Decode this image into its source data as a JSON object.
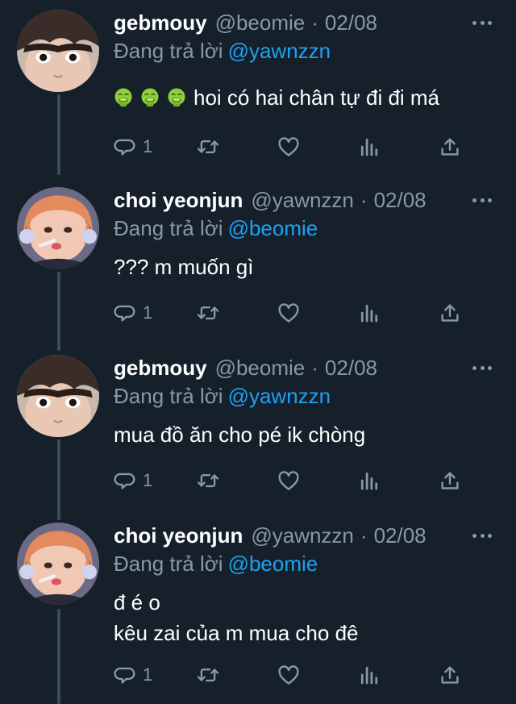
{
  "reply_prefix": "Đang trả lời",
  "icons": {
    "reply": "reply-icon",
    "retweet": "retweet-icon",
    "like": "heart-icon",
    "analytics": "analytics-icon",
    "share": "share-icon",
    "more": "more-icon",
    "emoji": "nauseated-face-emoji"
  },
  "colors": {
    "background": "#15202b",
    "secondary_text": "#8899a6",
    "mention": "#1da1f2",
    "thread_line": "#3d4b59"
  },
  "tweets": [
    {
      "name": "gebmouy",
      "handle": "@beomie",
      "separator": "·",
      "date": "02/08",
      "reply_to": "@yawnzzn",
      "text": "hoi có hai chân tự đi đi má",
      "reply_count": "1"
    },
    {
      "name": "choi yeonjun",
      "handle": "@yawnzzn",
      "separator": "·",
      "date": "02/08",
      "reply_to": "@beomie",
      "text": "??? m muốn gì",
      "reply_count": "1"
    },
    {
      "name": "gebmouy",
      "handle": "@beomie",
      "separator": "·",
      "date": "02/08",
      "reply_to": "@yawnzzn",
      "text": "mua đồ ăn cho pé ik chòng",
      "reply_count": "1"
    },
    {
      "name": "choi yeonjun",
      "handle": "@yawnzzn",
      "separator": "·",
      "date": "02/08",
      "reply_to": "@beomie",
      "text_line1": "đ é o",
      "text_line2": "kêu zai của m mua cho đê",
      "reply_count": "1"
    }
  ]
}
